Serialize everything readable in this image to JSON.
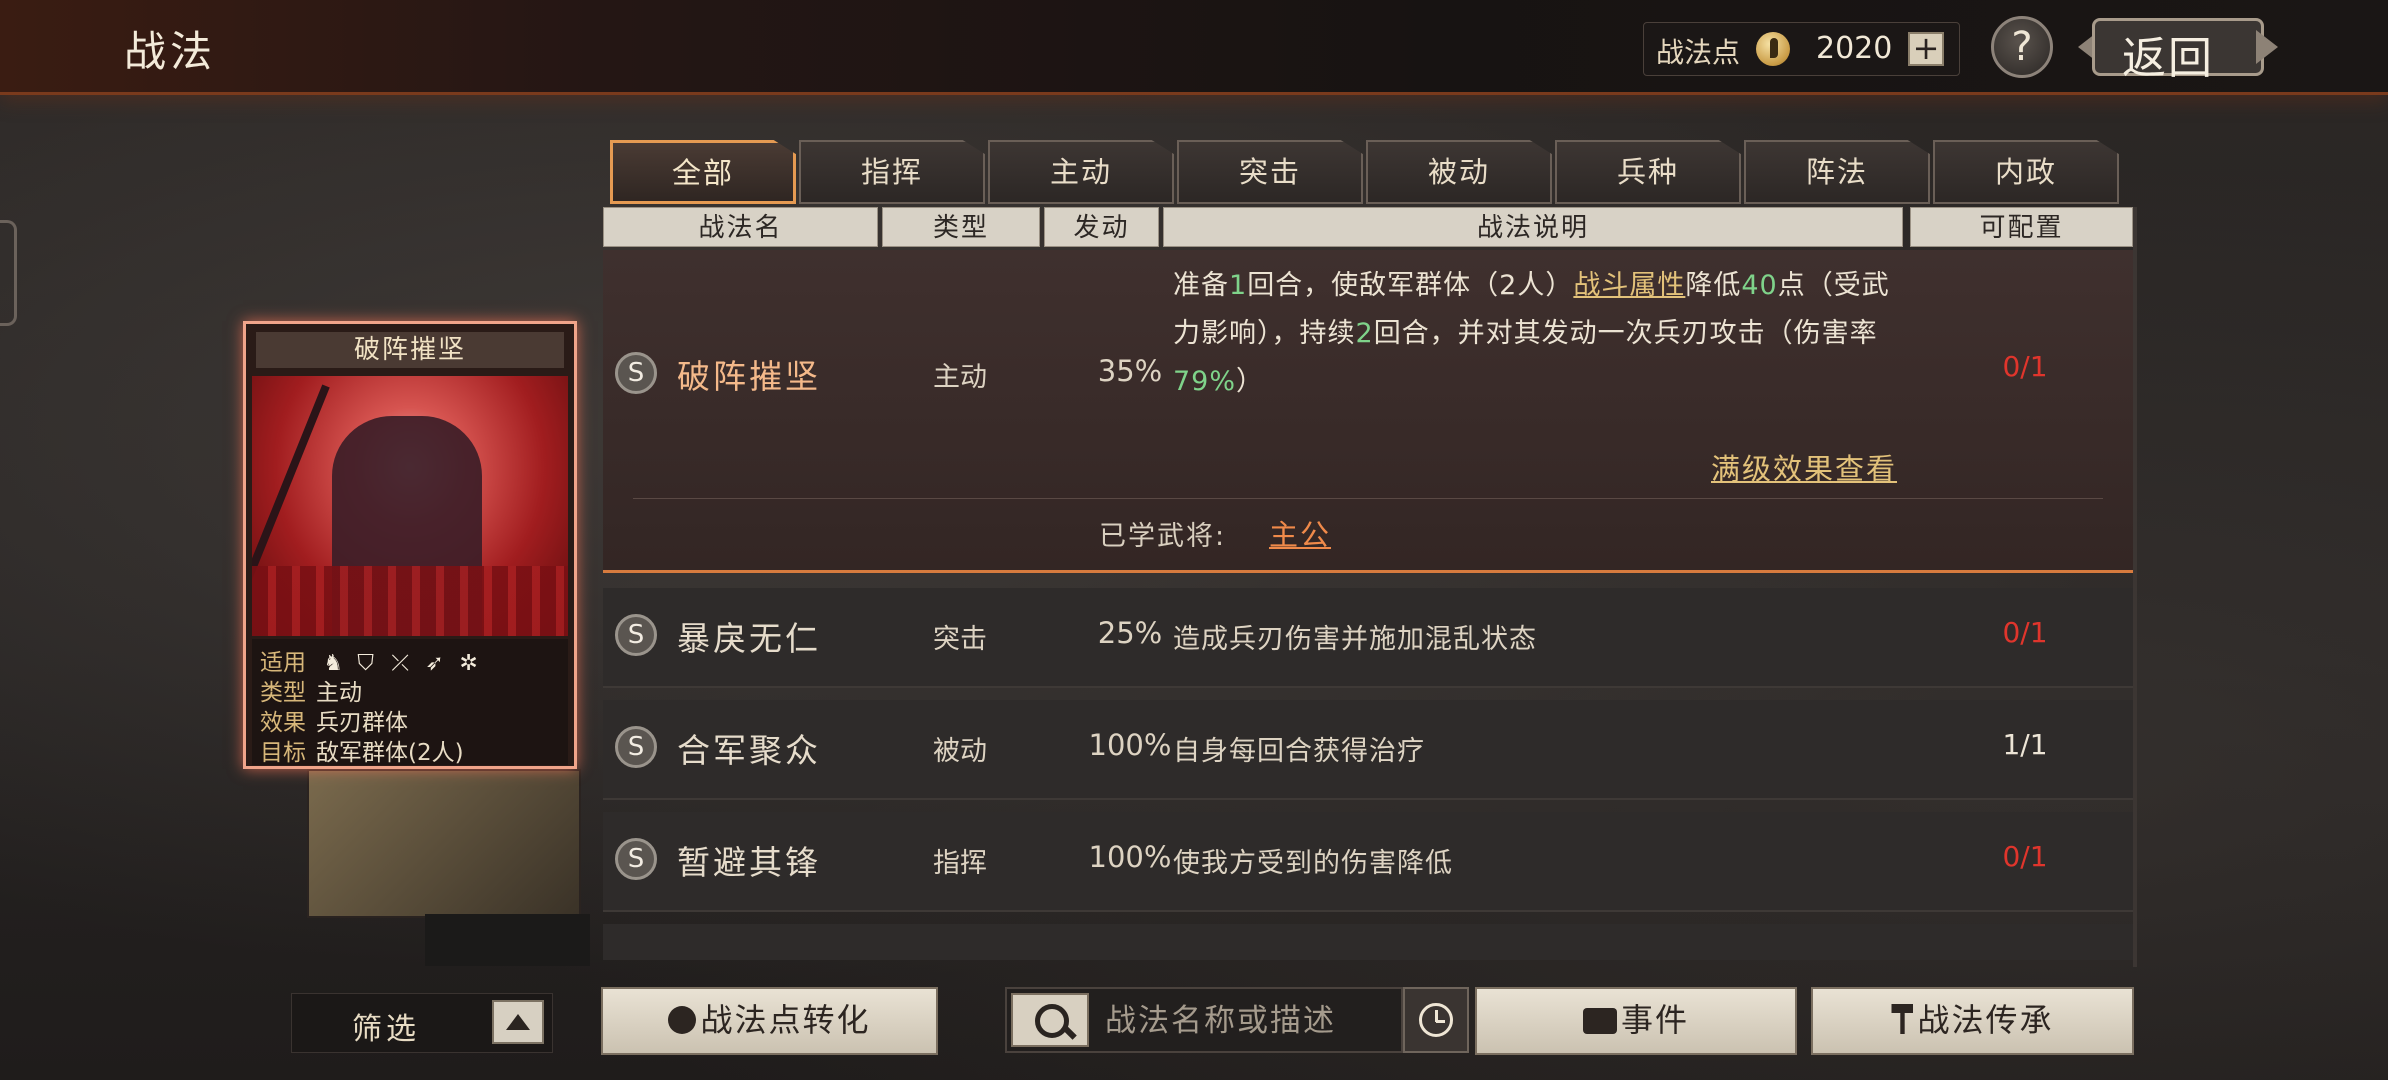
{
  "header": {
    "title": "战法",
    "points_label": "战法点",
    "points_value": "2020",
    "plus": "+",
    "help": "?",
    "back_label": "返回"
  },
  "card": {
    "title": "破阵摧坚",
    "rows": [
      {
        "key": "适用",
        "value": ""
      },
      {
        "key": "类型",
        "value": "主动"
      },
      {
        "key": "效果",
        "value": "兵刃群体"
      },
      {
        "key": "目标",
        "value": "敌军群体(2人)"
      }
    ],
    "unit_icons": [
      "cavalry-icon",
      "shield-icon",
      "bow-icon",
      "spear-icon",
      "wheel-icon"
    ]
  },
  "tabs": [
    {
      "label": "全部",
      "active": true
    },
    {
      "label": "指挥",
      "active": false
    },
    {
      "label": "主动",
      "active": false
    },
    {
      "label": "突击",
      "active": false
    },
    {
      "label": "被动",
      "active": false
    },
    {
      "label": "兵种",
      "active": false
    },
    {
      "label": "阵法",
      "active": false
    },
    {
      "label": "内政",
      "active": false
    }
  ],
  "columns": [
    "战法名",
    "类型",
    "发动",
    "战法说明",
    "可配置"
  ],
  "skills": [
    {
      "grade": "S",
      "name": "破阵摧坚",
      "type": "主动",
      "rate": "35%",
      "desc_parts": {
        "p1": "准备",
        "n1": "1",
        "p2": "回合，使敌军群体（2人）",
        "link": "战斗属性",
        "p3": "降低",
        "n2": "40",
        "p4": "点（受武力影响），持续",
        "n3": "2",
        "p5": "回合，并对其发动一次兵刃攻击（伤害率",
        "n4": "79%",
        "p6": "）"
      },
      "config": "0/1",
      "max_effect_link": "满级效果查看",
      "learned_label": "已学武将:",
      "learned_name": "主公"
    },
    {
      "grade": "S",
      "name": "暴戾无仁",
      "type": "突击",
      "rate": "25%",
      "desc": "造成兵刃伤害并施加混乱状态",
      "config": "0/1"
    },
    {
      "grade": "S",
      "name": "合军聚众",
      "type": "被动",
      "rate": "100%",
      "desc": "自身每回合获得治疗",
      "config": "1/1"
    },
    {
      "grade": "S",
      "name": "暂避其锋",
      "type": "指挥",
      "rate": "100%",
      "desc": "使我方受到的伤害降低",
      "config": "0/1"
    }
  ],
  "bottom": {
    "filter_label": "筛选",
    "convert_label": "战法点转化",
    "search_placeholder": "战法名称或描述",
    "event_label": "事件",
    "inherit_label": "战法传承"
  },
  "colors": {
    "accent": "#e59a52",
    "red": "#e0352c",
    "green": "#7fd38a",
    "link": "#e3c27a",
    "learned": "#f08a4a"
  }
}
